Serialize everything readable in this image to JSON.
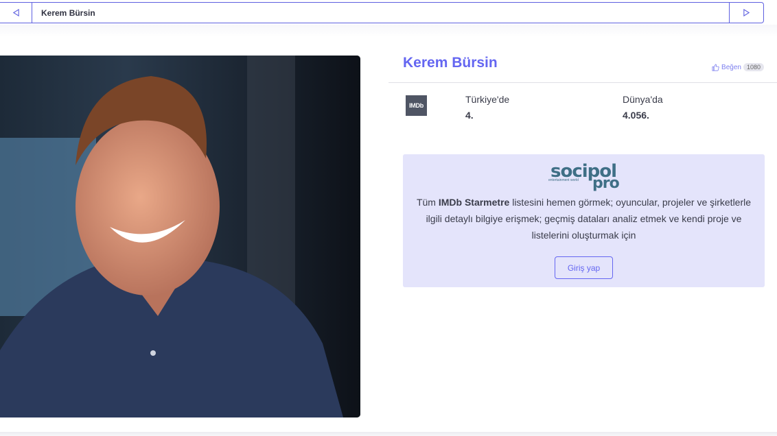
{
  "nav": {
    "breadcrumb": "Kerem Bürsin",
    "prev_icon": "chevron-left-icon",
    "next_icon": "chevron-right-icon"
  },
  "profile": {
    "name": "Kerem Bürsin",
    "like_label": "Beğen",
    "like_count": "1080",
    "photo": "portrait photo of actor"
  },
  "ranks": {
    "source_logo": "IMDb",
    "turkey_label": "Türkiye'de",
    "turkey_value": "4.",
    "world_label": "Dünya'da",
    "world_value": "4.056."
  },
  "promo": {
    "logo_main": "socipol",
    "logo_sub": "entertainment world",
    "logo_pro": "pro",
    "text_before": "Tüm ",
    "text_strong": "IMDb Starmetre",
    "text_after": " listesini hemen görmek; oyuncular, projeler ve şirketlerle ilgili detaylı bilgiye erişmek; geçmiş dataları analiz etmek ve kendi proje ve listelerini oluşturmak için",
    "login_label": "Giriş yap"
  },
  "colors": {
    "accent": "#6466f1",
    "promo_bg": "#e4e4fb",
    "logo": "#3f6f86"
  }
}
